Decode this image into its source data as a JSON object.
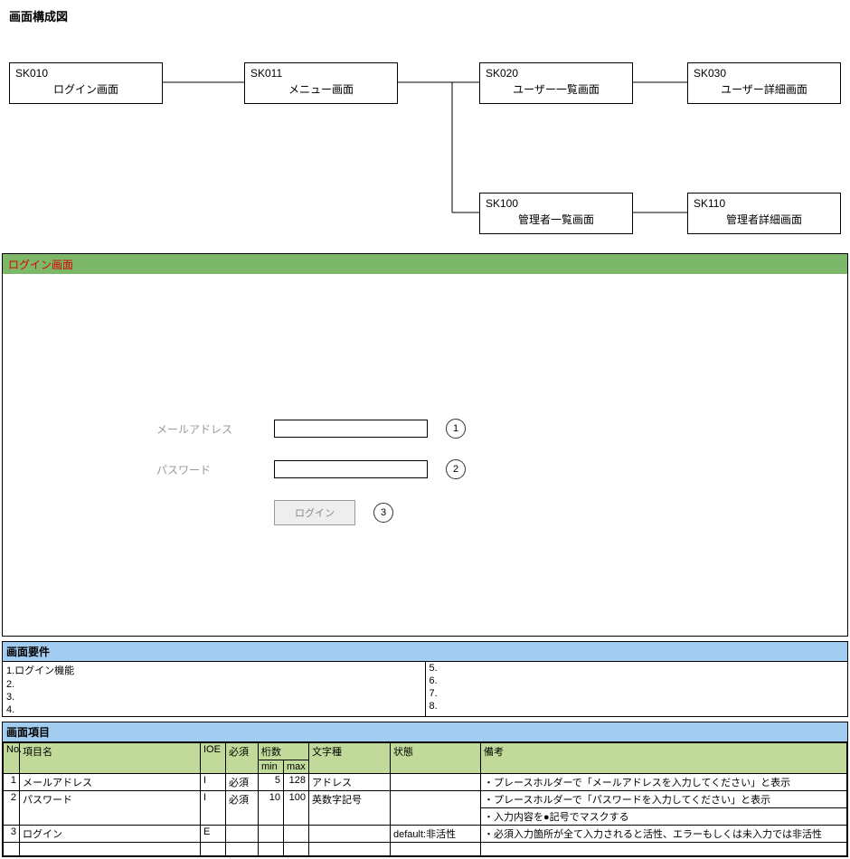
{
  "diagram": {
    "title": "画面構成図",
    "screens": {
      "sk010": {
        "code": "SK010",
        "name": "ログイン画面"
      },
      "sk011": {
        "code": "SK011",
        "name": "メニュー画面"
      },
      "sk020": {
        "code": "SK020",
        "name": "ユーザー一覧画面"
      },
      "sk030": {
        "code": "SK030",
        "name": "ユーザー詳細画面"
      },
      "sk100": {
        "code": "SK100",
        "name": "管理者一覧画面"
      },
      "sk110": {
        "code": "SK110",
        "name": "管理者詳細画面"
      }
    }
  },
  "mockup": {
    "header_title": "ログイン画面",
    "email_label": "メールアドレス",
    "password_label": "パスワード",
    "login_button": "ログイン",
    "marker1": "1",
    "marker2": "2",
    "marker3": "3"
  },
  "requirements": {
    "title": "画面要件",
    "left": [
      "1.ログイン機能",
      "2.",
      "3.",
      "4."
    ],
    "right": [
      "5.",
      "6.",
      "7.",
      "8."
    ]
  },
  "items": {
    "title": "画面項目",
    "headers": {
      "no": "No.",
      "name": "項目名",
      "ioe": "IOE",
      "required": "必須",
      "digits": "桁数",
      "min": "min",
      "max": "max",
      "chartype": "文字種",
      "state": "状態",
      "notes": "備考"
    },
    "rows": [
      {
        "no": "1",
        "name": "メールアドレス",
        "ioe": "I",
        "required": "必須",
        "min": "5",
        "max": "128",
        "chartype": "アドレス",
        "state": "",
        "notes": [
          "・プレースホルダーで「メールアドレスを入力してください」と表示"
        ]
      },
      {
        "no": "2",
        "name": "パスワード",
        "ioe": "I",
        "required": "必須",
        "min": "10",
        "max": "100",
        "chartype": "英数字記号",
        "state": "",
        "notes": [
          "・プレースホルダーで「パスワードを入力してください」と表示",
          "・入力内容を●記号でマスクする"
        ]
      },
      {
        "no": "3",
        "name": "ログイン",
        "ioe": "E",
        "required": "",
        "min": "",
        "max": "",
        "chartype": "",
        "state": "default:非活性",
        "notes": [
          "・必須入力箇所が全て入力されると活性、エラーもしくは未入力では非活性"
        ]
      }
    ]
  }
}
